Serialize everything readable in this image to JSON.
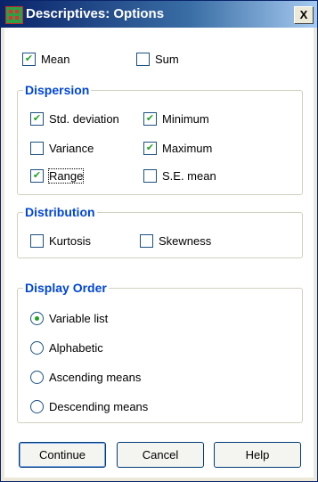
{
  "window": {
    "title": "Descriptives: Options",
    "close_label": "X"
  },
  "top_options": [
    {
      "label": "Mean",
      "checked": true
    },
    {
      "label": "Sum",
      "checked": false
    }
  ],
  "dispersion": {
    "legend": "Dispersion",
    "items": [
      {
        "label": "Std. deviation",
        "checked": true
      },
      {
        "label": "Minimum",
        "checked": true
      },
      {
        "label": "Variance",
        "checked": false
      },
      {
        "label": "Maximum",
        "checked": true
      },
      {
        "label": "Range",
        "checked": true
      },
      {
        "label": "S.E. mean",
        "checked": false
      }
    ]
  },
  "distribution": {
    "legend": "Distribution",
    "items": [
      {
        "label": "Kurtosis",
        "checked": false
      },
      {
        "label": "Skewness",
        "checked": false
      }
    ]
  },
  "display_order": {
    "legend": "Display Order",
    "options": [
      {
        "label": "Variable list",
        "selected": true
      },
      {
        "label": "Alphabetic",
        "selected": false
      },
      {
        "label": "Ascending means",
        "selected": false
      },
      {
        "label": "Descending means",
        "selected": false
      }
    ]
  },
  "buttons": {
    "continue": "Continue",
    "cancel": "Cancel",
    "help": "Help"
  }
}
